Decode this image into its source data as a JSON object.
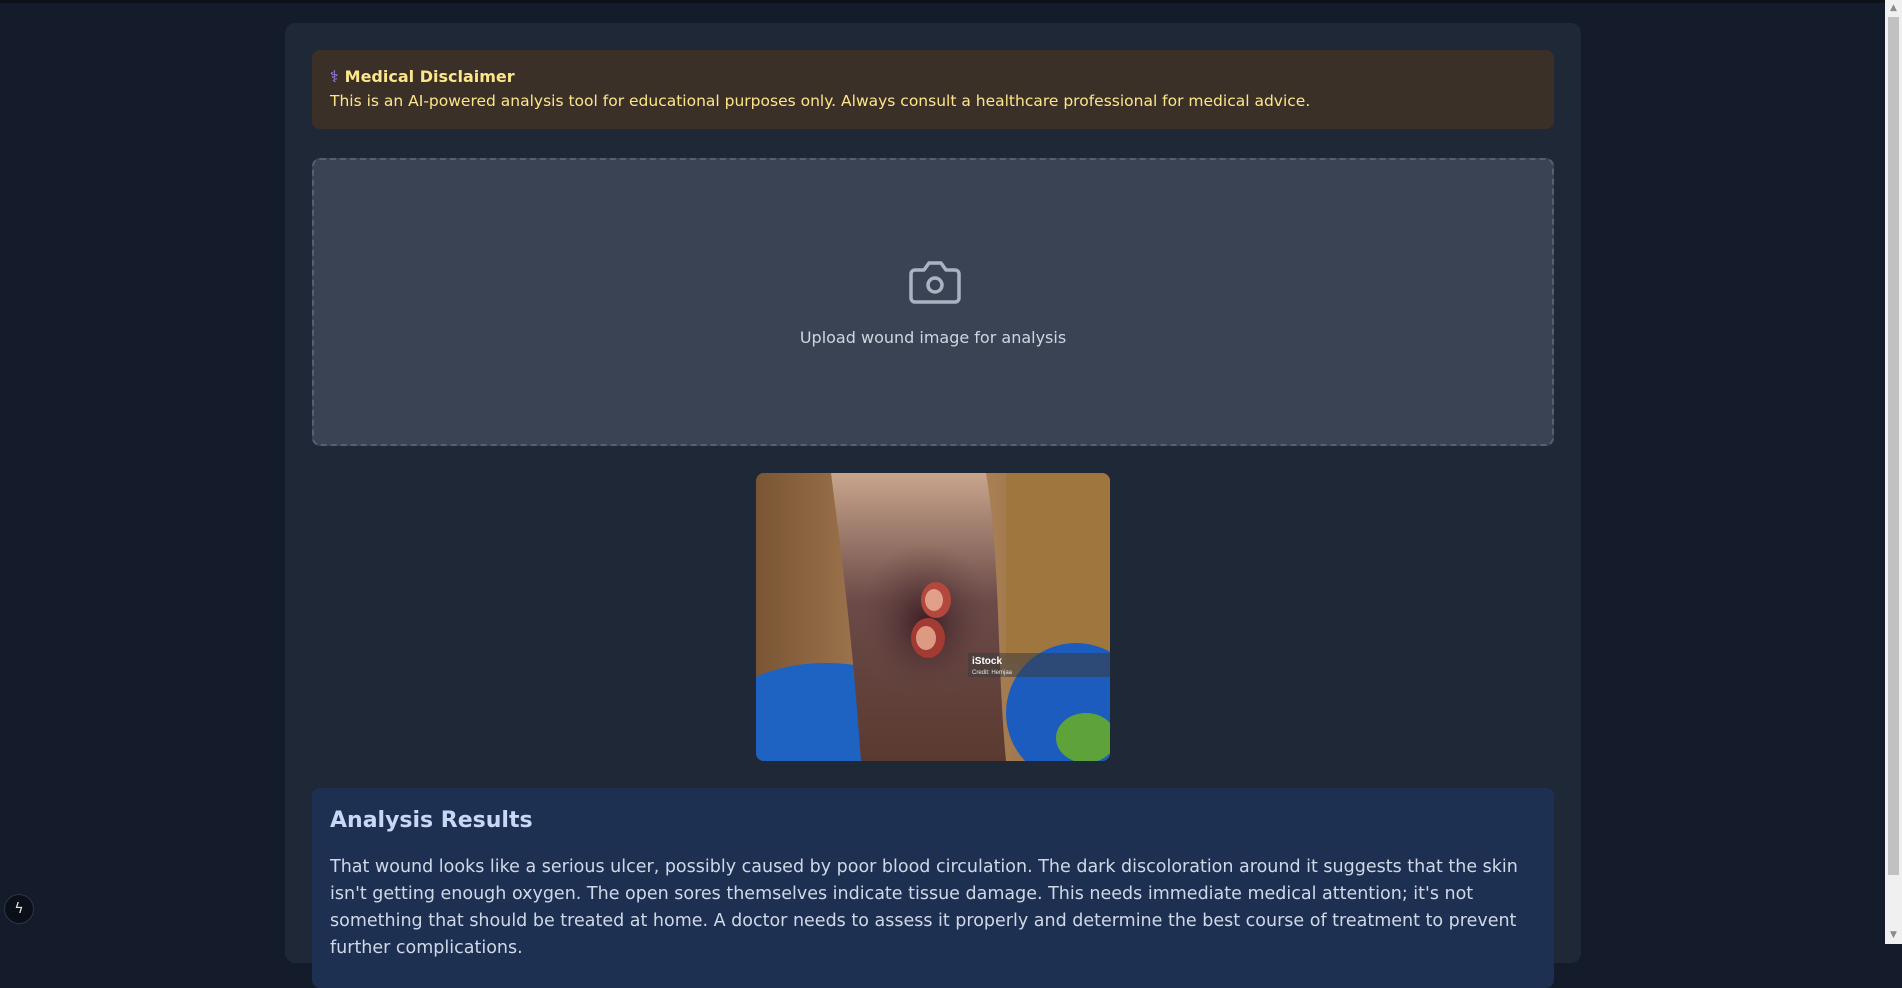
{
  "disclaimer": {
    "icon": "caduceus-icon",
    "title": "Medical Disclaimer",
    "text": "This is an AI-powered analysis tool for educational purposes only. Always consult a healthcare professional for medical advice."
  },
  "upload": {
    "icon": "camera-icon",
    "label": "Upload wound image for analysis"
  },
  "preview": {
    "watermark_brand": "iStock",
    "watermark_credit": "Credit: Hemjaa"
  },
  "results": {
    "title": "Analysis Results",
    "text": "That wound looks like a serious ulcer, possibly caused by poor blood circulation. The dark discoloration around it suggests that the skin isn't getting enough oxygen. The open sores themselves indicate tissue damage. This needs immediate medical attention; it's not something that should be treated at home. A doctor needs to assess it properly and determine the best course of treatment to prevent further complications."
  },
  "colors": {
    "page_bg": "#141b2b",
    "card_bg": "#1f2837",
    "disclaimer_bg": "#3a3028",
    "disclaimer_text": "#fde68a",
    "upload_bg": "#3a4354",
    "results_bg": "#1e3052"
  }
}
